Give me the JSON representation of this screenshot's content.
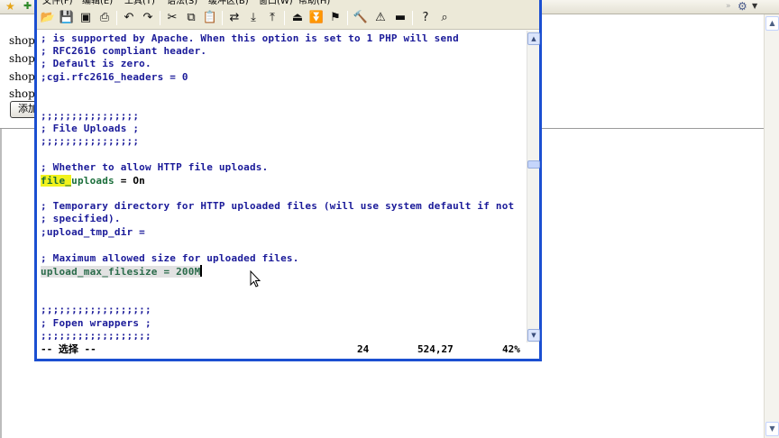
{
  "background_page": {
    "shop_lines": [
      "shopp",
      "shopp",
      "shopp",
      "shopp"
    ],
    "add_button_label": "添加",
    "accent_color": "#e6a417"
  },
  "vim": {
    "menu": [
      "文件(F)",
      "编辑(E)",
      "工具(T)",
      "语法(S)",
      "缓冲区(B)",
      "窗口(W)",
      "帮助(H)"
    ],
    "toolbar_icons": [
      "open-icon",
      "save-icon",
      "save-all-icon",
      "print-icon",
      "undo-icon",
      "redo-icon",
      "cut-icon",
      "copy-icon",
      "paste-icon",
      "replace-icon",
      "find-next-icon",
      "find-prev-icon",
      "load-session-icon",
      "save-session-icon",
      "run-script-icon",
      "make-icon",
      "shell-icon",
      "ctags-icon",
      "help-icon",
      "find-help-icon"
    ],
    "lines": {
      "l1": "; is supported by Apache. When this option is set to 1 PHP will send",
      "l2": "; RFC2616 compliant header.",
      "l3": "; Default is zero.",
      "l4": ";cgi.rfc2616_headers = 0",
      "l5": ";;;;;;;;;;;;;;;;",
      "l6": "; File Uploads ;",
      "l7": ";;;;;;;;;;;;;;;;",
      "l8": "; Whether to allow HTTP file uploads.",
      "l9a": "file_",
      "l9b": "uploads",
      "l9c": " = On",
      "l10": "; Temporary directory for HTTP uploaded files (will use system default if not",
      "l11": "; specified).",
      "l12": ";upload_tmp_dir =",
      "l13": "; Maximum allowed size for uploaded files.",
      "l14": "upload_max_filesize = 200M",
      "l15": ";;;;;;;;;;;;;;;;;;",
      "l16": "; Fopen wrappers ;",
      "l17": ";;;;;;;;;;;;;;;;;;"
    },
    "status": {
      "mode": "-- 选择 --",
      "count": "24",
      "position": "524,27",
      "percent": "42%"
    },
    "colors": {
      "window_border": "#1b4fd1",
      "comment": "#1a1a99",
      "search_highlight": "#f1f21d",
      "keyword_green": "#1a6e3a"
    }
  }
}
